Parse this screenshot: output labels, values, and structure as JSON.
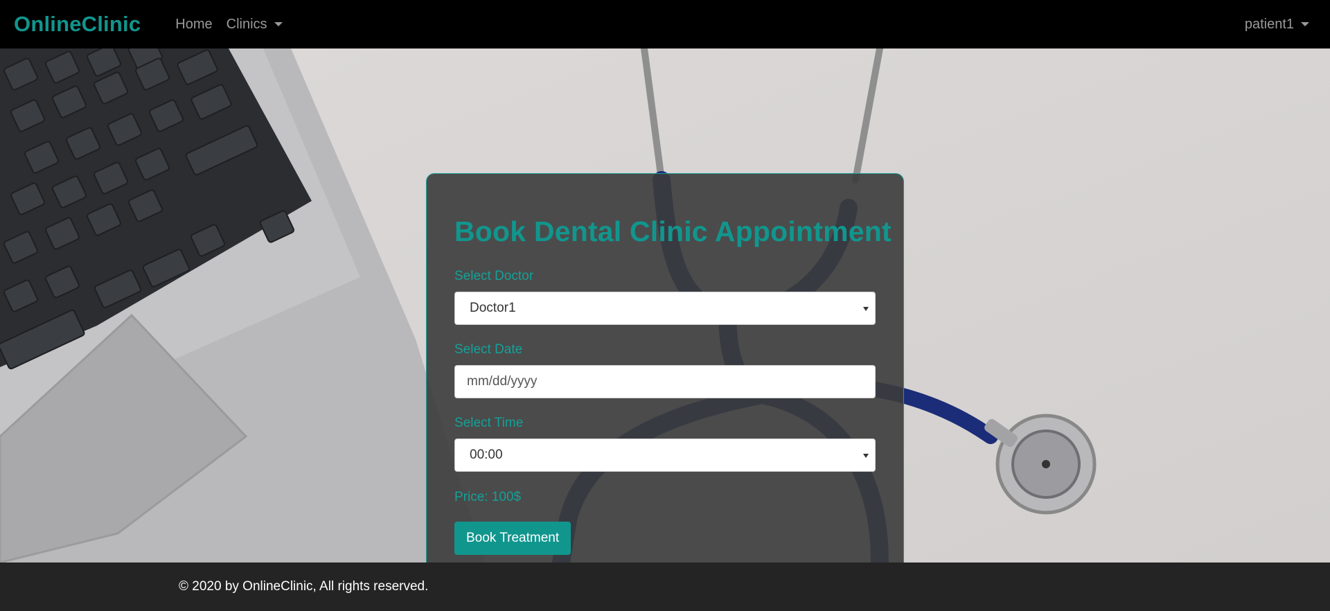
{
  "navbar": {
    "brand": "OnlineClinic",
    "links": [
      {
        "label": "Home"
      },
      {
        "label": "Clinics"
      }
    ],
    "user": "patient1"
  },
  "form": {
    "title": "Book Dental Clinic Appointment",
    "doctor_label": "Select Doctor",
    "doctor_value": "Doctor1",
    "date_label": "Select Date",
    "date_placeholder": "mm/dd/yyyy",
    "time_label": "Select Time",
    "time_value": "00:00",
    "price": "Price: 100$",
    "submit_label": "Book Treatment"
  },
  "footer": {
    "text": "© 2020 by OnlineClinic, All rights reserved."
  },
  "colors": {
    "accent": "#11968e",
    "navbar": "#000000",
    "footer": "#242424"
  }
}
